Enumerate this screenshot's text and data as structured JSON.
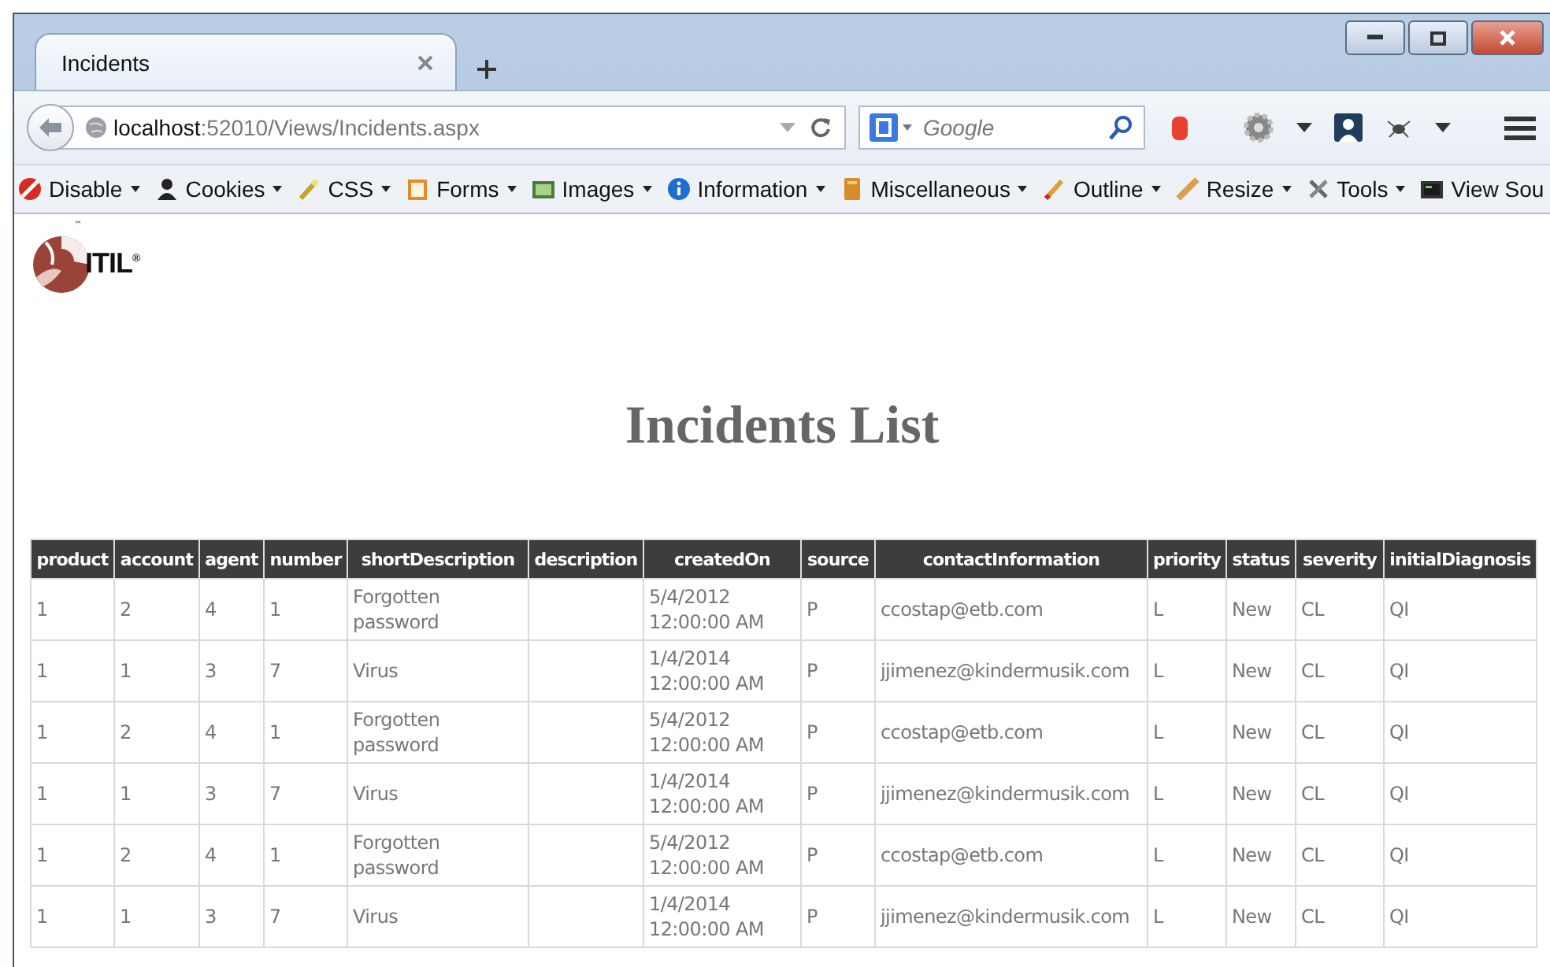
{
  "window": {
    "tab_title": "Incidents",
    "url_host": "localhost",
    "url_path": ":52010/Views/Incidents.aspx",
    "search_placeholder": "Google"
  },
  "toolbar": [
    {
      "label": "Disable"
    },
    {
      "label": "Cookies"
    },
    {
      "label": "CSS"
    },
    {
      "label": "Forms"
    },
    {
      "label": "Images"
    },
    {
      "label": "Information"
    },
    {
      "label": "Miscellaneous"
    },
    {
      "label": "Outline"
    },
    {
      "label": "Resize"
    },
    {
      "label": "Tools"
    },
    {
      "label": "View Sou"
    }
  ],
  "logo": {
    "text": "ITIL",
    "mark": "®",
    "tm": "™"
  },
  "heading": "Incidents List",
  "table": {
    "columns": [
      "product",
      "account",
      "agent",
      "number",
      "shortDescription",
      "description",
      "createdOn",
      "source",
      "contactInformation",
      "priority",
      "status",
      "severity",
      "initialDiagnosis"
    ],
    "rows": [
      [
        "1",
        "2",
        "4",
        "1",
        "Forgotten password",
        "",
        "5/4/2012 12:00:00 AM",
        "P",
        "ccostap@etb.com",
        "L",
        "New",
        "CL",
        "QI"
      ],
      [
        "1",
        "1",
        "3",
        "7",
        "Virus",
        "",
        "1/4/2014 12:00:00 AM",
        "P",
        "jjimenez@kindermusik.com",
        "L",
        "New",
        "CL",
        "QI"
      ],
      [
        "1",
        "2",
        "4",
        "1",
        "Forgotten password",
        "",
        "5/4/2012 12:00:00 AM",
        "P",
        "ccostap@etb.com",
        "L",
        "New",
        "CL",
        "QI"
      ],
      [
        "1",
        "1",
        "3",
        "7",
        "Virus",
        "",
        "1/4/2014 12:00:00 AM",
        "P",
        "jjimenez@kindermusik.com",
        "L",
        "New",
        "CL",
        "QI"
      ],
      [
        "1",
        "2",
        "4",
        "1",
        "Forgotten password",
        "",
        "5/4/2012 12:00:00 AM",
        "P",
        "ccostap@etb.com",
        "L",
        "New",
        "CL",
        "QI"
      ],
      [
        "1",
        "1",
        "3",
        "7",
        "Virus",
        "",
        "1/4/2014 12:00:00 AM",
        "P",
        "jjimenez@kindermusik.com",
        "L",
        "New",
        "CL",
        "QI"
      ]
    ]
  }
}
